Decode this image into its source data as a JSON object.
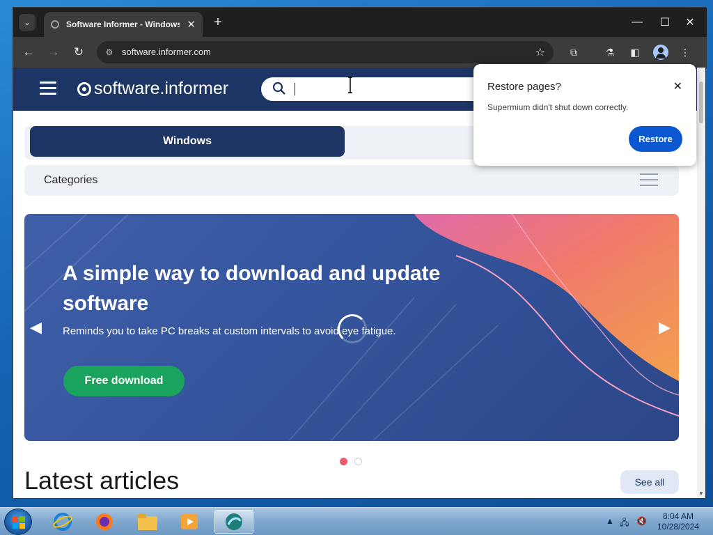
{
  "browser": {
    "tab_title": "Software Informer - Windows s",
    "url": "software.informer.com",
    "new_tab_symbol": "+",
    "icons": [
      "tab-search-icon",
      "close-icon",
      "back-icon",
      "forward-icon",
      "reload-icon",
      "site-info-icon",
      "star-icon",
      "extensions-icon",
      "labs-icon",
      "sidebar-icon",
      "profile-icon",
      "menu-icon"
    ]
  },
  "site": {
    "logo_text": "software.informer",
    "search_placeholder": "",
    "platform_tab_active": "Windows",
    "categories_label": "Categories",
    "banner": {
      "title": "A simple way to download and update software",
      "subtitle": "Reminds you to take PC breaks at custom intervals to avoid eye fatigue.",
      "button_label": "Free download",
      "active_slide": 1,
      "slide_count": 2
    },
    "latest_heading": "Latest articles",
    "see_all_label": "See all"
  },
  "popup": {
    "title": "Restore pages?",
    "message": "Supermium didn't shut down correctly.",
    "button_label": "Restore"
  },
  "taskbar": {
    "time": "8:04 AM",
    "date": "10/28/2024",
    "apps": [
      "internet-explorer-icon",
      "firefox-icon",
      "file-explorer-icon",
      "media-player-icon",
      "supermium-icon"
    ]
  },
  "colors": {
    "site_header": "#1d3565",
    "free_download": "#1aa35d",
    "restore_button": "#0b57d0",
    "active_dot": "#ec5a6b"
  }
}
